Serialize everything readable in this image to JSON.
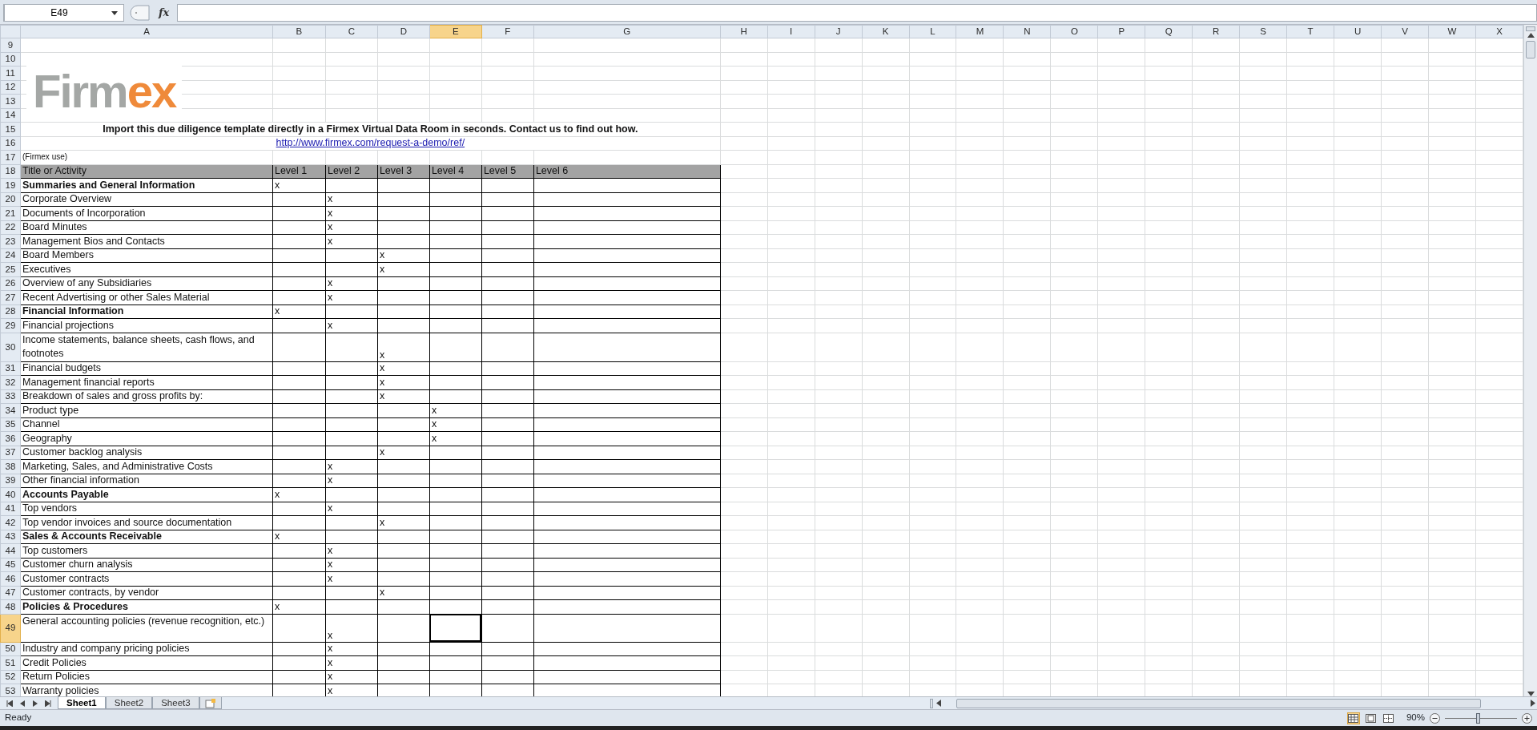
{
  "name_box": {
    "value": "E49"
  },
  "function_label": "fx",
  "logo": {
    "parts": [
      {
        "text": "Firm",
        "color": "#a4a7a5"
      },
      {
        "text": "ex",
        "color": "#ef8a3a"
      }
    ]
  },
  "columns": [
    {
      "letter": "A",
      "selected": false
    },
    {
      "letter": "B",
      "selected": false
    },
    {
      "letter": "C",
      "selected": false
    },
    {
      "letter": "D",
      "selected": false
    },
    {
      "letter": "E",
      "selected": true
    },
    {
      "letter": "F",
      "selected": false
    },
    {
      "letter": "G",
      "selected": false
    },
    {
      "letter": "H",
      "selected": false
    },
    {
      "letter": "I",
      "selected": false
    },
    {
      "letter": "J",
      "selected": false
    },
    {
      "letter": "K",
      "selected": false
    },
    {
      "letter": "L",
      "selected": false
    },
    {
      "letter": "M",
      "selected": false
    },
    {
      "letter": "N",
      "selected": false
    },
    {
      "letter": "O",
      "selected": false
    },
    {
      "letter": "P",
      "selected": false
    },
    {
      "letter": "Q",
      "selected": false
    },
    {
      "letter": "R",
      "selected": false
    },
    {
      "letter": "S",
      "selected": false
    },
    {
      "letter": "T",
      "selected": false
    },
    {
      "letter": "U",
      "selected": false
    },
    {
      "letter": "V",
      "selected": false
    },
    {
      "letter": "W",
      "selected": false
    },
    {
      "letter": "X",
      "selected": false
    }
  ],
  "rows": [
    {
      "number": "9",
      "kind": "blank",
      "selected": false
    },
    {
      "number": "10",
      "kind": "blank",
      "selected": false
    },
    {
      "number": "11",
      "kind": "blank",
      "selected": false
    },
    {
      "number": "12",
      "kind": "blank",
      "selected": false
    },
    {
      "number": "13",
      "kind": "blank",
      "selected": false
    },
    {
      "number": "14",
      "kind": "blank",
      "selected": false
    },
    {
      "number": "15",
      "kind": "banner",
      "selected": false,
      "text": "Import this due diligence template directly in a Firmex Virtual Data Room in seconds. Contact us to find out how."
    },
    {
      "number": "16",
      "kind": "link",
      "selected": false,
      "text": "http://www.firmex.com/request-a-demo/ref/"
    },
    {
      "number": "17",
      "kind": "note",
      "selected": false,
      "note": "(Firmex use)"
    },
    {
      "number": "18",
      "kind": "header",
      "selected": false,
      "cells": [
        "Title or Activity",
        "Level 1",
        "Level 2",
        "Level 3",
        "Level 4",
        "Level 5",
        "Level 6"
      ]
    },
    {
      "number": "19",
      "kind": "item",
      "selected": false,
      "label": "Summaries and General Information",
      "bold": true,
      "mark": "x",
      "levels": [
        {
          "marked": true
        },
        {
          "marked": false
        },
        {
          "marked": false
        },
        {
          "marked": false
        },
        {
          "marked": false
        },
        {
          "marked": false
        }
      ]
    },
    {
      "number": "20",
      "kind": "item",
      "selected": false,
      "label": "Corporate Overview",
      "bold": false,
      "mark": "x",
      "levels": [
        {
          "marked": false
        },
        {
          "marked": true
        },
        {
          "marked": false
        },
        {
          "marked": false
        },
        {
          "marked": false
        },
        {
          "marked": false
        }
      ]
    },
    {
      "number": "21",
      "kind": "item",
      "selected": false,
      "label": "Documents of Incorporation",
      "bold": false,
      "mark": "x",
      "levels": [
        {
          "marked": false
        },
        {
          "marked": true
        },
        {
          "marked": false
        },
        {
          "marked": false
        },
        {
          "marked": false
        },
        {
          "marked": false
        }
      ]
    },
    {
      "number": "22",
      "kind": "item",
      "selected": false,
      "label": "Board Minutes",
      "bold": false,
      "mark": "x",
      "levels": [
        {
          "marked": false
        },
        {
          "marked": true
        },
        {
          "marked": false
        },
        {
          "marked": false
        },
        {
          "marked": false
        },
        {
          "marked": false
        }
      ]
    },
    {
      "number": "23",
      "kind": "item",
      "selected": false,
      "label": "Management Bios and Contacts",
      "bold": false,
      "mark": "x",
      "levels": [
        {
          "marked": false
        },
        {
          "marked": true
        },
        {
          "marked": false
        },
        {
          "marked": false
        },
        {
          "marked": false
        },
        {
          "marked": false
        }
      ]
    },
    {
      "number": "24",
      "kind": "item",
      "selected": false,
      "label": "Board Members",
      "bold": false,
      "mark": "x",
      "levels": [
        {
          "marked": false
        },
        {
          "marked": false
        },
        {
          "marked": true
        },
        {
          "marked": false
        },
        {
          "marked": false
        },
        {
          "marked": false
        }
      ]
    },
    {
      "number": "25",
      "kind": "item",
      "selected": false,
      "label": "Executives",
      "bold": false,
      "mark": "x",
      "levels": [
        {
          "marked": false
        },
        {
          "marked": false
        },
        {
          "marked": true
        },
        {
          "marked": false
        },
        {
          "marked": false
        },
        {
          "marked": false
        }
      ]
    },
    {
      "number": "26",
      "kind": "item",
      "selected": false,
      "label": "Overview of any Subsidiaries",
      "bold": false,
      "mark": "x",
      "levels": [
        {
          "marked": false
        },
        {
          "marked": true
        },
        {
          "marked": false
        },
        {
          "marked": false
        },
        {
          "marked": false
        },
        {
          "marked": false
        }
      ]
    },
    {
      "number": "27",
      "kind": "item",
      "selected": false,
      "label": "Recent Advertising or other Sales Material",
      "bold": false,
      "mark": "x",
      "levels": [
        {
          "marked": false
        },
        {
          "marked": true
        },
        {
          "marked": false
        },
        {
          "marked": false
        },
        {
          "marked": false
        },
        {
          "marked": false
        }
      ]
    },
    {
      "number": "28",
      "kind": "item",
      "selected": false,
      "label": "Financial Information",
      "bold": true,
      "mark": "x",
      "levels": [
        {
          "marked": true
        },
        {
          "marked": false
        },
        {
          "marked": false
        },
        {
          "marked": false
        },
        {
          "marked": false
        },
        {
          "marked": false
        }
      ]
    },
    {
      "number": "29",
      "kind": "item",
      "selected": false,
      "label": "Financial projections",
      "bold": false,
      "mark": "x",
      "levels": [
        {
          "marked": false
        },
        {
          "marked": true
        },
        {
          "marked": false
        },
        {
          "marked": false
        },
        {
          "marked": false
        },
        {
          "marked": false
        }
      ]
    },
    {
      "number": "30",
      "kind": "item",
      "selected": false,
      "label": "Income statements, balance sheets, cash flows, and footnotes",
      "bold": false,
      "mark": "x",
      "levels": [
        {
          "marked": false
        },
        {
          "marked": false
        },
        {
          "marked": true
        },
        {
          "marked": false
        },
        {
          "marked": false
        },
        {
          "marked": false
        }
      ],
      "tall": true
    },
    {
      "number": "31",
      "kind": "item",
      "selected": false,
      "label": "Financial budgets",
      "bold": false,
      "mark": "x",
      "levels": [
        {
          "marked": false
        },
        {
          "marked": false
        },
        {
          "marked": true
        },
        {
          "marked": false
        },
        {
          "marked": false
        },
        {
          "marked": false
        }
      ]
    },
    {
      "number": "32",
      "kind": "item",
      "selected": false,
      "label": "Management financial reports",
      "bold": false,
      "mark": "x",
      "levels": [
        {
          "marked": false
        },
        {
          "marked": false
        },
        {
          "marked": true
        },
        {
          "marked": false
        },
        {
          "marked": false
        },
        {
          "marked": false
        }
      ]
    },
    {
      "number": "33",
      "kind": "item",
      "selected": false,
      "label": "Breakdown of sales and gross profits by:",
      "bold": false,
      "mark": "x",
      "levels": [
        {
          "marked": false
        },
        {
          "marked": false
        },
        {
          "marked": true
        },
        {
          "marked": false
        },
        {
          "marked": false
        },
        {
          "marked": false
        }
      ]
    },
    {
      "number": "34",
      "kind": "item",
      "selected": false,
      "label": "Product type",
      "bold": false,
      "mark": "x",
      "levels": [
        {
          "marked": false
        },
        {
          "marked": false
        },
        {
          "marked": false
        },
        {
          "marked": true
        },
        {
          "marked": false
        },
        {
          "marked": false
        }
      ]
    },
    {
      "number": "35",
      "kind": "item",
      "selected": false,
      "label": "Channel",
      "bold": false,
      "mark": "x",
      "levels": [
        {
          "marked": false
        },
        {
          "marked": false
        },
        {
          "marked": false
        },
        {
          "marked": true
        },
        {
          "marked": false
        },
        {
          "marked": false
        }
      ]
    },
    {
      "number": "36",
      "kind": "item",
      "selected": false,
      "label": "Geography",
      "bold": false,
      "mark": "x",
      "levels": [
        {
          "marked": false
        },
        {
          "marked": false
        },
        {
          "marked": false
        },
        {
          "marked": true
        },
        {
          "marked": false
        },
        {
          "marked": false
        }
      ]
    },
    {
      "number": "37",
      "kind": "item",
      "selected": false,
      "label": "Customer backlog analysis",
      "bold": false,
      "mark": "x",
      "levels": [
        {
          "marked": false
        },
        {
          "marked": false
        },
        {
          "marked": true
        },
        {
          "marked": false
        },
        {
          "marked": false
        },
        {
          "marked": false
        }
      ]
    },
    {
      "number": "38",
      "kind": "item",
      "selected": false,
      "label": "Marketing, Sales, and Administrative Costs",
      "bold": false,
      "mark": "x",
      "levels": [
        {
          "marked": false
        },
        {
          "marked": true
        },
        {
          "marked": false
        },
        {
          "marked": false
        },
        {
          "marked": false
        },
        {
          "marked": false
        }
      ]
    },
    {
      "number": "39",
      "kind": "item",
      "selected": false,
      "label": "Other financial information",
      "bold": false,
      "mark": "x",
      "levels": [
        {
          "marked": false
        },
        {
          "marked": true
        },
        {
          "marked": false
        },
        {
          "marked": false
        },
        {
          "marked": false
        },
        {
          "marked": false
        }
      ]
    },
    {
      "number": "40",
      "kind": "item",
      "selected": false,
      "label": "Accounts Payable",
      "bold": true,
      "mark": "x",
      "levels": [
        {
          "marked": true
        },
        {
          "marked": false
        },
        {
          "marked": false
        },
        {
          "marked": false
        },
        {
          "marked": false
        },
        {
          "marked": false
        }
      ]
    },
    {
      "number": "41",
      "kind": "item",
      "selected": false,
      "label": "Top vendors",
      "bold": false,
      "mark": "x",
      "levels": [
        {
          "marked": false
        },
        {
          "marked": true
        },
        {
          "marked": false
        },
        {
          "marked": false
        },
        {
          "marked": false
        },
        {
          "marked": false
        }
      ]
    },
    {
      "number": "42",
      "kind": "item",
      "selected": false,
      "label": "Top vendor invoices and source documentation",
      "bold": false,
      "mark": "x",
      "levels": [
        {
          "marked": false
        },
        {
          "marked": false
        },
        {
          "marked": true
        },
        {
          "marked": false
        },
        {
          "marked": false
        },
        {
          "marked": false
        }
      ]
    },
    {
      "number": "43",
      "kind": "item",
      "selected": false,
      "label": "Sales & Accounts Receivable",
      "bold": true,
      "mark": "x",
      "levels": [
        {
          "marked": true
        },
        {
          "marked": false
        },
        {
          "marked": false
        },
        {
          "marked": false
        },
        {
          "marked": false
        },
        {
          "marked": false
        }
      ]
    },
    {
      "number": "44",
      "kind": "item",
      "selected": false,
      "label": "Top customers",
      "bold": false,
      "mark": "x",
      "levels": [
        {
          "marked": false
        },
        {
          "marked": true
        },
        {
          "marked": false
        },
        {
          "marked": false
        },
        {
          "marked": false
        },
        {
          "marked": false
        }
      ]
    },
    {
      "number": "45",
      "kind": "item",
      "selected": false,
      "label": "Customer churn analysis",
      "bold": false,
      "mark": "x",
      "levels": [
        {
          "marked": false
        },
        {
          "marked": true
        },
        {
          "marked": false
        },
        {
          "marked": false
        },
        {
          "marked": false
        },
        {
          "marked": false
        }
      ]
    },
    {
      "number": "46",
      "kind": "item",
      "selected": false,
      "label": "Customer contracts",
      "bold": false,
      "mark": "x",
      "levels": [
        {
          "marked": false
        },
        {
          "marked": true
        },
        {
          "marked": false
        },
        {
          "marked": false
        },
        {
          "marked": false
        },
        {
          "marked": false
        }
      ]
    },
    {
      "number": "47",
      "kind": "item",
      "selected": false,
      "label": "Customer contracts, by vendor",
      "bold": false,
      "mark": "x",
      "levels": [
        {
          "marked": false
        },
        {
          "marked": false
        },
        {
          "marked": true
        },
        {
          "marked": false
        },
        {
          "marked": false
        },
        {
          "marked": false
        }
      ]
    },
    {
      "number": "48",
      "kind": "item",
      "selected": false,
      "label": "Policies & Procedures",
      "bold": true,
      "mark": "x",
      "levels": [
        {
          "marked": true
        },
        {
          "marked": false
        },
        {
          "marked": false
        },
        {
          "marked": false
        },
        {
          "marked": false
        },
        {
          "marked": false
        }
      ]
    },
    {
      "number": "49",
      "kind": "item",
      "selected": true,
      "label": "General accounting policies (revenue recognition, etc.)",
      "bold": false,
      "mark": "x",
      "levels": [
        {
          "marked": false
        },
        {
          "marked": true
        },
        {
          "marked": false
        },
        {
          "marked": false
        },
        {
          "marked": false
        },
        {
          "marked": false
        }
      ],
      "tall": true
    },
    {
      "number": "50",
      "kind": "item",
      "selected": false,
      "label": "Industry and company pricing policies",
      "bold": false,
      "mark": "x",
      "levels": [
        {
          "marked": false
        },
        {
          "marked": true
        },
        {
          "marked": false
        },
        {
          "marked": false
        },
        {
          "marked": false
        },
        {
          "marked": false
        }
      ]
    },
    {
      "number": "51",
      "kind": "item",
      "selected": false,
      "label": "Credit Policies",
      "bold": false,
      "mark": "x",
      "levels": [
        {
          "marked": false
        },
        {
          "marked": true
        },
        {
          "marked": false
        },
        {
          "marked": false
        },
        {
          "marked": false
        },
        {
          "marked": false
        }
      ]
    },
    {
      "number": "52",
      "kind": "item",
      "selected": false,
      "label": "Return Policies",
      "bold": false,
      "mark": "x",
      "levels": [
        {
          "marked": false
        },
        {
          "marked": true
        },
        {
          "marked": false
        },
        {
          "marked": false
        },
        {
          "marked": false
        },
        {
          "marked": false
        }
      ]
    },
    {
      "number": "53",
      "kind": "item",
      "selected": false,
      "label": "Warranty policies",
      "bold": false,
      "mark": "x",
      "levels": [
        {
          "marked": false
        },
        {
          "marked": true
        },
        {
          "marked": false
        },
        {
          "marked": false
        },
        {
          "marked": false
        },
        {
          "marked": false
        }
      ]
    }
  ],
  "sheets": [
    {
      "name": "Sheet1",
      "selected": true
    },
    {
      "name": "Sheet2",
      "selected": false
    },
    {
      "name": "Sheet3",
      "selected": false
    }
  ],
  "status_bar": {
    "text": "Ready",
    "views": [
      {
        "selected": true
      },
      {
        "selected": false
      },
      {
        "selected": false
      }
    ],
    "zoom": {
      "reading": "90%",
      "level": 0.47
    }
  }
}
